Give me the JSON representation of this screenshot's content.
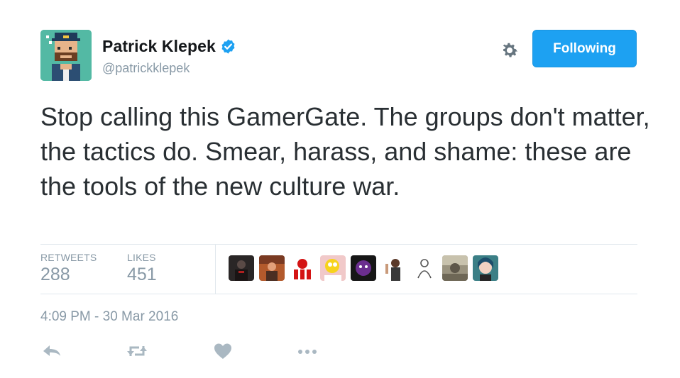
{
  "user": {
    "display_name": "Patrick Klepek",
    "handle": "@patrickklepek",
    "verified": true
  },
  "header": {
    "follow_button_label": "Following",
    "gear_icon": "gear-icon"
  },
  "tweet": {
    "text": "Stop calling this GamerGate. The groups don't matter, the tactics do. Smear, harass, and shame: these are the tools of the new culture war."
  },
  "stats": {
    "retweets_label": "RETWEETS",
    "retweets_count": "288",
    "likes_label": "LIKES",
    "likes_count": "451"
  },
  "timestamp": "4:09 PM - 30 Mar 2016",
  "actions": [
    "reply-icon",
    "retweet-icon",
    "like-icon",
    "more-icon"
  ],
  "colors": {
    "accent": "#1da1f2",
    "text": "#292f33",
    "muted": "#8899a6",
    "divider": "#e1e8ed"
  }
}
